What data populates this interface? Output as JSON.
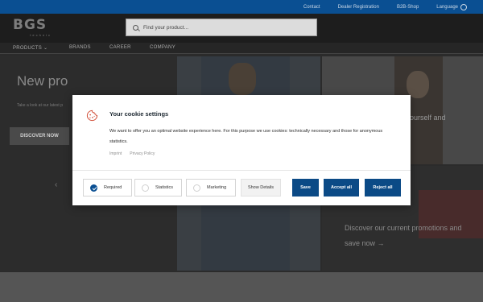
{
  "topbar": {
    "links": [
      "Contact",
      "Dealer Registration",
      "B2B-Shop"
    ],
    "language_label": "Language",
    "accent_color": "#0a4f92"
  },
  "header": {
    "logo_text": "BGS",
    "logo_subtext": "technic",
    "search_placeholder": "Find your product..."
  },
  "nav": {
    "items": [
      "PRODUCTS",
      "BRANDS",
      "CAREER",
      "COMPANY"
    ]
  },
  "hero": {
    "title": "New pro",
    "subtitle": "Take a look at our latest p",
    "button_label": "DISCOVER NOW",
    "prev_icon": "chevron-left-icon",
    "next_icon": "chevron-right-icon"
  },
  "promos": {
    "top_text": "ourself and",
    "bottom_text": "Discover our current promotions and save now →"
  },
  "cookie_dialog": {
    "title": "Your cookie settings",
    "text": "We want to offer you an optimal website experience here. For this purpose we use cookies: technically necessary and those for anonymous statistics.",
    "links": [
      "Imprint",
      "Privacy Policy"
    ],
    "options": [
      {
        "label": "Required",
        "checked": true
      },
      {
        "label": "Statistics",
        "checked": false
      },
      {
        "label": "Marketing",
        "checked": false
      }
    ],
    "show_details_label": "Show Details",
    "save_label": "Save",
    "accept_label": "Accept all",
    "reject_label": "Reject all",
    "button_color": "#0b4a86"
  }
}
